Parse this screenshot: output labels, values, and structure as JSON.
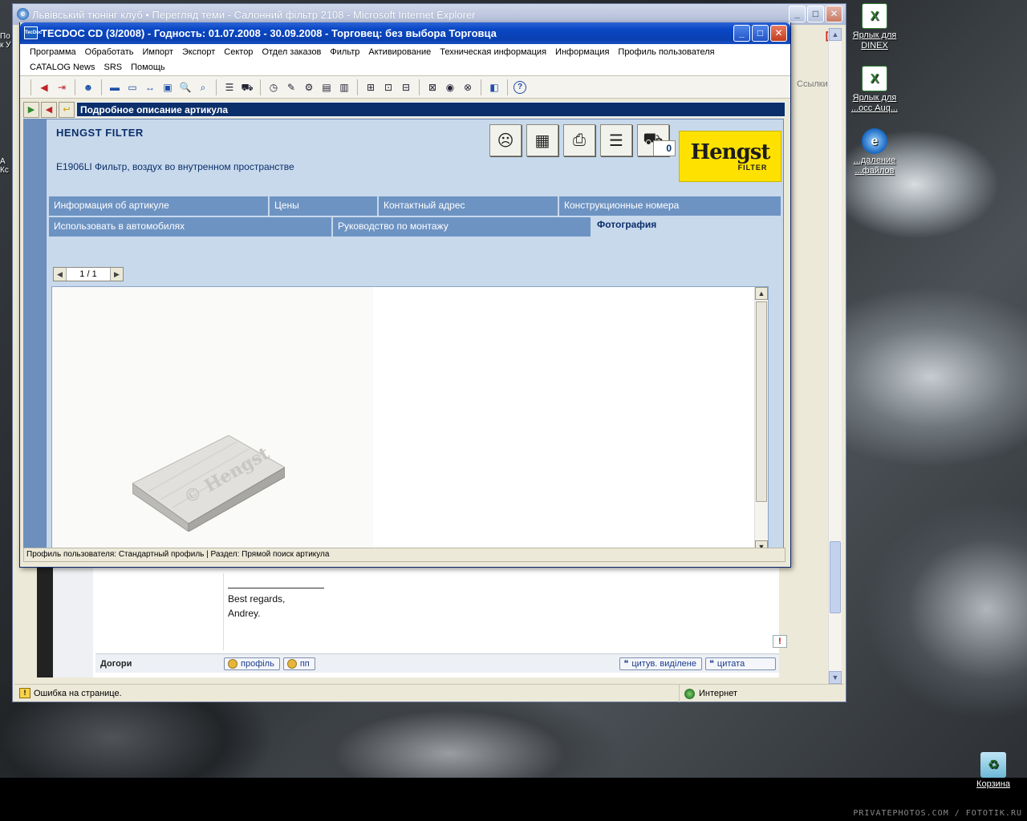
{
  "desktop": {
    "icons": [
      {
        "id": "excel-dinex",
        "label": "Ярлык для DINEX"
      },
      {
        "id": "excel-2",
        "label": "Ярлык для ...осс Auq..."
      },
      {
        "id": "ie-delete",
        "label": "...даление ...файлов"
      },
      {
        "id": "recycle-bin",
        "label": "Корзина"
      }
    ],
    "left_cut_labels": [
      "По",
      "к У",
      "А",
      "Кс"
    ],
    "watermark": "PRIVATEPHOTOS.COM / FOTOTIK.RU"
  },
  "ie_window": {
    "title": "Львівський тюнінг клуб • Перегляд теми - Салонний фільтр 2108 - Microsoft Internet Explorer",
    "links_label": "Ссылки",
    "forum_signature": [
      "Best regards,",
      "Andrey."
    ],
    "poster_row_label": "Догори",
    "profile_button": "профіль",
    "pm_button": "пп",
    "quote_selected_button": "цитув. виділене",
    "quote_button": "цитата",
    "report_glyph": "!",
    "status_text": "Ошибка на странице.",
    "zone_text": "Интернет"
  },
  "tecdoc": {
    "title": "TECDOC CD (3/2008)  -  Годность: 01.07.2008 - 30.09.2008  -  Торговец: без выбора Торговца",
    "menu": [
      "Программа",
      "Обработать",
      "Импорт",
      "Экспорт",
      "Сектор",
      "Отдел заказов",
      "Фильтр",
      "Активирование",
      "Техническая информация",
      "Информация",
      "Профиль пользователя",
      "CATALOG News",
      "SRS",
      "Помощь"
    ],
    "nav_title": "Подробное описание артикула",
    "supplier": "HENGST FILTER",
    "article_desc": "E1906LI Фильтр, воздух во внутренном пространстве",
    "qty": "0",
    "brand_logo_big": "Hengst",
    "brand_logo_sub": "FILTER",
    "tabs_row1": [
      "Информация об артикуле",
      "Цены",
      "Контактный адрес",
      "Конструкционные номера"
    ],
    "tabs_row2": [
      "Использовать в автомобилях",
      "Руководство по монтажу",
      "Фотография"
    ],
    "pager_text": "1  /  1",
    "photo_watermark": "© Hengst",
    "status_text": "Профиль пользователя: Стандартный профиль | Раздел: Прямой поиск артикула"
  },
  "colors": {
    "title_blue": "#0a48c6",
    "panel_bg": "#c8d9ec",
    "tab_bg": "#6d93c3",
    "nav_dark": "#0b2f6a",
    "brand_yellow": "#ffe100"
  }
}
